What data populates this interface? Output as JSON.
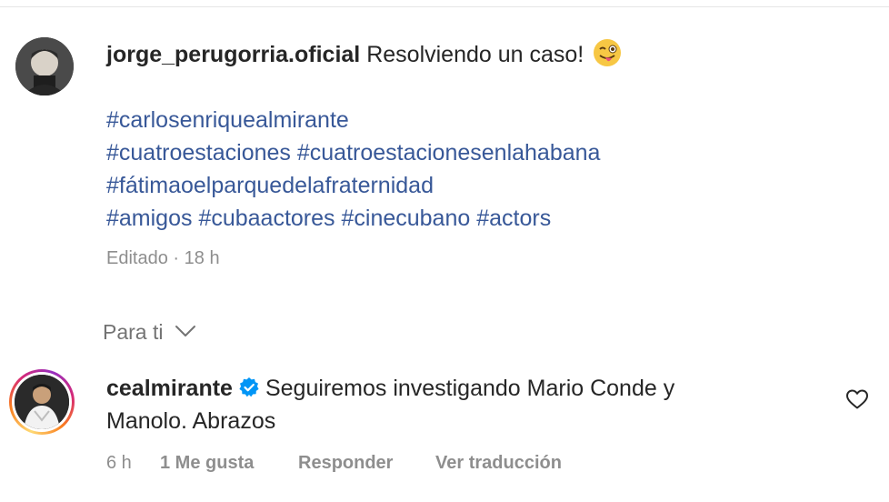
{
  "post": {
    "username": "jorge_perugorria.oficial",
    "caption": "Resolviendo un caso!",
    "caption_emoji": "winking-face-with-tongue",
    "hashtag_lines": [
      "#carlosenriquealmirante",
      "#cuatroestaciones #cuatroestacionesenlahabana",
      "#fátimaoelparquedelafraternidad",
      "#amigos #cubaactores #cinecubano #actors"
    ],
    "edited_label": "Editado",
    "separator": "·",
    "time": "18 h"
  },
  "filter": {
    "label": "Para ti",
    "icon": "chevron-down-icon"
  },
  "comment": {
    "username": "cealmirante",
    "verified_icon": "verified-badge-icon",
    "text_line1": "Seguiremos investigando Mario Conde y",
    "text_line2": "Manolo. Abrazos",
    "time": "6 h",
    "likes": "1 Me gusta",
    "reply_label": "Responder",
    "translate_label": "Ver traducción",
    "like_icon": "heart-icon"
  },
  "colors": {
    "hashtag": "#385898",
    "verified": "#0095f6",
    "muted": "#8e8e8e"
  }
}
